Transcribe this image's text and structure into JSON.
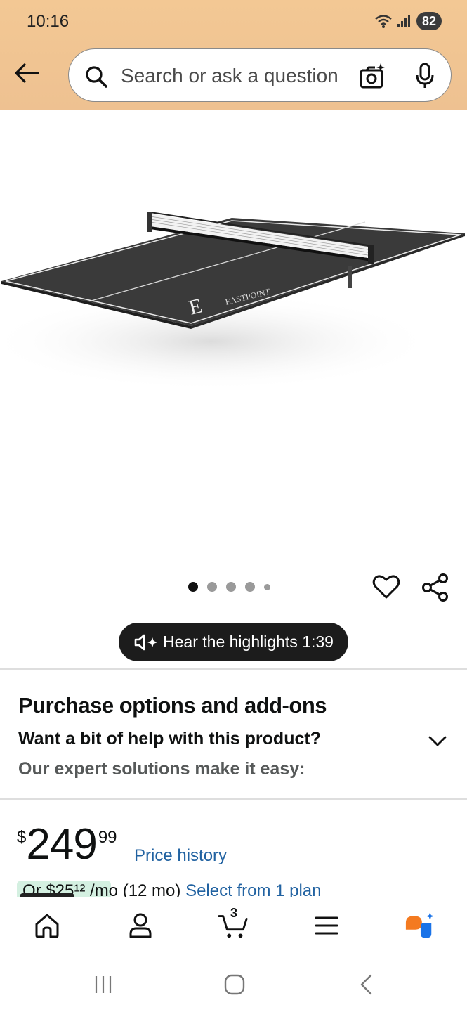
{
  "status_bar": {
    "time": "10:16",
    "battery": "82"
  },
  "search": {
    "placeholder": "Search or ask a question"
  },
  "product": {
    "image_alt": "EastPoint table tennis conversion top",
    "brand_mark": "EASTPOINT",
    "image_count": 5,
    "active_image": 1
  },
  "highlights": {
    "label": "Hear the highlights 1:39"
  },
  "options": {
    "title": "Purchase options and add-ons",
    "help_question": "Want a bit of help with this product?",
    "help_subtitle": "Our expert solutions make it easy:"
  },
  "pricing": {
    "currency": "$",
    "whole": "249",
    "fraction": "99",
    "price_history": "Price history",
    "plan_text": "Or $25¹² /mo (12 mo)",
    "plan_link": "Select from 1 plan"
  },
  "nav": {
    "cart_count": "3"
  },
  "colors": {
    "header": "#f3c894",
    "link": "#2162a1",
    "plan_badge": "#d4f0e1",
    "pill": "#1c1c1c"
  }
}
